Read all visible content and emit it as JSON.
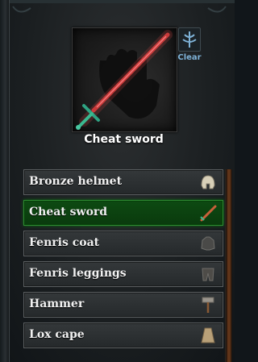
{
  "selected_item": {
    "name": "Cheat sword",
    "icon": "sword-icon"
  },
  "clear_button": {
    "label": "Clear",
    "icon": "clear-icon"
  },
  "items": [
    {
      "label": "Bronze helmet",
      "icon": "helmet-icon",
      "selected": false
    },
    {
      "label": "Cheat sword",
      "icon": "sword-icon",
      "selected": true
    },
    {
      "label": "Fenris coat",
      "icon": "coat-icon",
      "selected": false
    },
    {
      "label": "Fenris leggings",
      "icon": "leggings-icon",
      "selected": false
    },
    {
      "label": "Hammer",
      "icon": "hammer-icon",
      "selected": false
    },
    {
      "label": "Lox cape",
      "icon": "cape-icon",
      "selected": false
    }
  ],
  "colors": {
    "selected_row": "#0d4a12",
    "row": "#2d3133",
    "clear_label": "#7fb3d8",
    "sword_glow": "#c83a3a"
  }
}
